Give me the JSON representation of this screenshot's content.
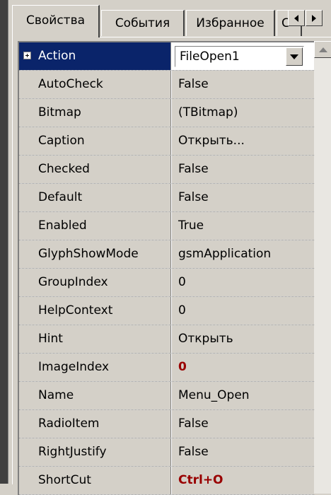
{
  "tabs": [
    {
      "label": "Свойства",
      "active": true
    },
    {
      "label": "События",
      "active": false
    },
    {
      "label": "Избранное",
      "active": false
    },
    {
      "label": "С",
      "active": false
    }
  ],
  "icons": {
    "tab_scroll_left": "triangle-left-icon",
    "tab_scroll_right": "triangle-right-icon",
    "combo_dropdown": "chevron-down-icon",
    "scroll_up": "triangle-up-icon",
    "expand": "plus-box-icon"
  },
  "colors": {
    "selection_bg": "#0a246a",
    "modified_value": "#990000",
    "panel_bg": "#d4d0c8"
  },
  "selected_property": {
    "name": "Action",
    "value": "FileOpen1"
  },
  "properties": [
    {
      "name": "AutoCheck",
      "value": "False",
      "modified": false
    },
    {
      "name": "Bitmap",
      "value": "(TBitmap)",
      "modified": false
    },
    {
      "name": "Caption",
      "value": "Открыть...",
      "modified": false
    },
    {
      "name": "Checked",
      "value": "False",
      "modified": false
    },
    {
      "name": "Default",
      "value": "False",
      "modified": false
    },
    {
      "name": "Enabled",
      "value": "True",
      "modified": false
    },
    {
      "name": "GlyphShowMode",
      "value": "gsmApplication",
      "modified": false
    },
    {
      "name": "GroupIndex",
      "value": "0",
      "modified": false
    },
    {
      "name": "HelpContext",
      "value": "0",
      "modified": false
    },
    {
      "name": "Hint",
      "value": "Открыть",
      "modified": false
    },
    {
      "name": "ImageIndex",
      "value": "0",
      "modified": true
    },
    {
      "name": "Name",
      "value": "Menu_Open",
      "modified": false
    },
    {
      "name": "RadioItem",
      "value": "False",
      "modified": false
    },
    {
      "name": "RightJustify",
      "value": "False",
      "modified": false
    },
    {
      "name": "ShortCut",
      "value": "Ctrl+O",
      "modified": true
    }
  ]
}
